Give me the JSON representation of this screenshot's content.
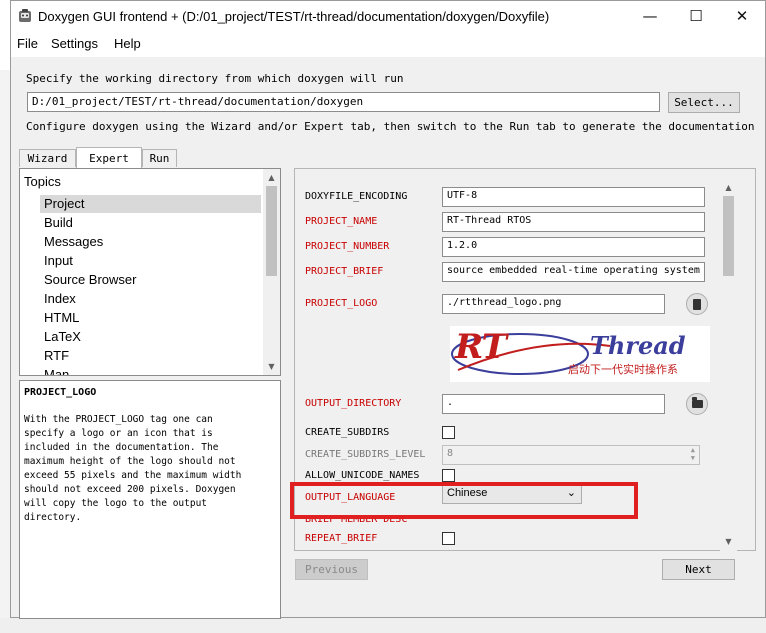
{
  "window": {
    "title": "Doxygen GUI frontend + (D:/01_project/TEST/rt-thread/documentation/doxygen/Doxyfile)",
    "controls": {
      "minimize": "—",
      "maximize": "☐",
      "close": "✕"
    }
  },
  "menu": [
    "File",
    "Settings",
    "Help"
  ],
  "working_dir": {
    "prompt": "Specify the working directory from which doxygen will run",
    "value": "D:/01_project/TEST/rt-thread/documentation/doxygen",
    "select_label": "Select..."
  },
  "configure_hint": "Configure doxygen using the Wizard and/or Expert tab, then switch to the Run tab to generate the documentation",
  "tabs": [
    {
      "label": "Wizard",
      "active": false
    },
    {
      "label": "Expert",
      "active": true
    },
    {
      "label": "Run",
      "active": false
    }
  ],
  "topics": {
    "heading": "Topics",
    "items": [
      "Project",
      "Build",
      "Messages",
      "Input",
      "Source Browser",
      "Index",
      "HTML",
      "LaTeX",
      "RTF",
      "Man"
    ],
    "selected": "Project"
  },
  "help": {
    "title": "PROJECT_LOGO",
    "body": "With the PROJECT_LOGO tag one can\nspecify a logo or an icon that is\nincluded in the documentation. The\nmaximum height of the logo should not\nexceed 55 pixels and the maximum width\nshould not exceed 200 pixels. Doxygen\nwill copy the logo to the output\ndirectory."
  },
  "settings": {
    "doxyfile_encoding": {
      "label": "DOXYFILE_ENCODING",
      "value": "UTF-8"
    },
    "project_name": {
      "label": "PROJECT_NAME",
      "value": "RT-Thread RTOS"
    },
    "project_number": {
      "label": "PROJECT_NUMBER",
      "value": "1.2.0"
    },
    "project_brief": {
      "label": "PROJECT_BRIEF",
      "value": "source embedded real-time operating system"
    },
    "project_logo": {
      "label": "PROJECT_LOGO",
      "value": "./rtthread_logo.png"
    },
    "logo_image": {
      "brand_left": "RT",
      "brand_right": "Thread",
      "tagline": "启动下一代实时操作系"
    },
    "output_directory": {
      "label": "OUTPUT_DIRECTORY",
      "value": "."
    },
    "create_subdirs": {
      "label": "CREATE_SUBDIRS",
      "checked": false
    },
    "create_subdirs_level": {
      "label": "CREATE_SUBDIRS_LEVEL",
      "value": "8"
    },
    "allow_unicode_names": {
      "label": "ALLOW_UNICODE_NAMES",
      "checked": false
    },
    "output_language": {
      "label": "OUTPUT_LANGUAGE",
      "value": "Chinese"
    },
    "brief_member_desc": {
      "label": "BRIEF_MEMBER_DESC"
    },
    "repeat_brief": {
      "label": "REPEAT_BRIEF",
      "checked": false
    }
  },
  "nav": {
    "previous": "Previous",
    "next": "Next"
  },
  "colors": {
    "red_label": "#c80000",
    "highlight": "#e02020",
    "selected_topic": "#d9d9d9"
  }
}
